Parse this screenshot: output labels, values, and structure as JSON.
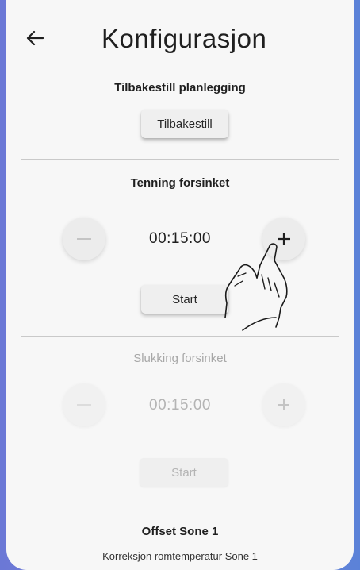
{
  "header": {
    "back_icon": "arrow-left-icon",
    "title": "Konfigurasjon"
  },
  "sections": {
    "reset": {
      "title": "Tilbakestill planlegging",
      "button_label": "Tilbakestill"
    },
    "ignition_delay": {
      "title": "Tenning forsinket",
      "time": "00:15:00",
      "minus_icon": "minus-icon",
      "plus_icon": "plus-icon",
      "start_label": "Start"
    },
    "shutdown_delay": {
      "title": "Slukking forsinket",
      "time": "00:15:00",
      "minus_icon": "minus-icon",
      "plus_icon": "plus-icon",
      "start_label": "Start",
      "state": "disabled"
    },
    "offset": {
      "title": "Offset Sone 1",
      "subtitle": "Korreksjon romtemperatur Sone 1"
    }
  },
  "overlay": {
    "pointer_icon": "tap-hand-icon"
  },
  "colors": {
    "background": "#f7f7f7",
    "frame_gradient": [
      "#6b78d6",
      "#5b82d8"
    ],
    "disabled_text": "#b4b4b4"
  }
}
